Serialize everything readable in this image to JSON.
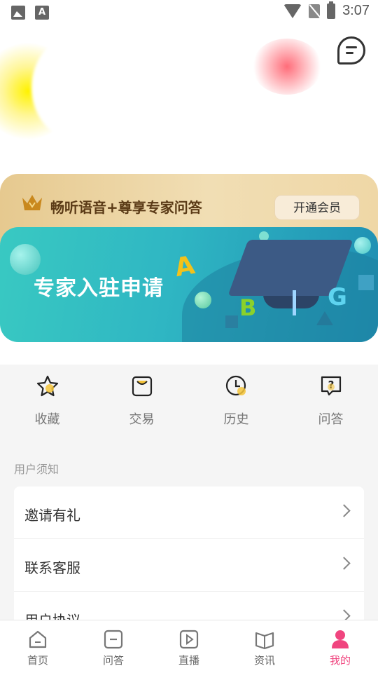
{
  "status_bar": {
    "time": "3:07",
    "icons": [
      "image-icon",
      "text-a-icon",
      "wifi-icon",
      "no-sim-icon",
      "battery-charging-icon"
    ]
  },
  "header": {
    "message_icon": "message-icon"
  },
  "vip": {
    "icon": "crown-icon",
    "text": "畅听语音+尊享专家问答",
    "button": "开通会员",
    "color": "#5a3a16"
  },
  "banner": {
    "title": "专家入驻申请",
    "letters": [
      "A",
      "B",
      "G"
    ]
  },
  "quick_actions": [
    {
      "label": "收藏",
      "icon": "star-icon"
    },
    {
      "label": "交易",
      "icon": "bag-icon"
    },
    {
      "label": "历史",
      "icon": "clock-icon"
    },
    {
      "label": "问答",
      "icon": "question-chat-icon"
    }
  ],
  "section": {
    "title": "用户须知"
  },
  "list": [
    {
      "label": "邀请有礼"
    },
    {
      "label": "联系客服"
    },
    {
      "label": "用户协议"
    }
  ],
  "nav": [
    {
      "label": "首页",
      "icon": "home-icon"
    },
    {
      "label": "问答",
      "icon": "qa-icon"
    },
    {
      "label": "直播",
      "icon": "play-icon"
    },
    {
      "label": "资讯",
      "icon": "book-icon"
    },
    {
      "label": "我的",
      "icon": "user-icon"
    }
  ],
  "accent_color": "#f0457f"
}
